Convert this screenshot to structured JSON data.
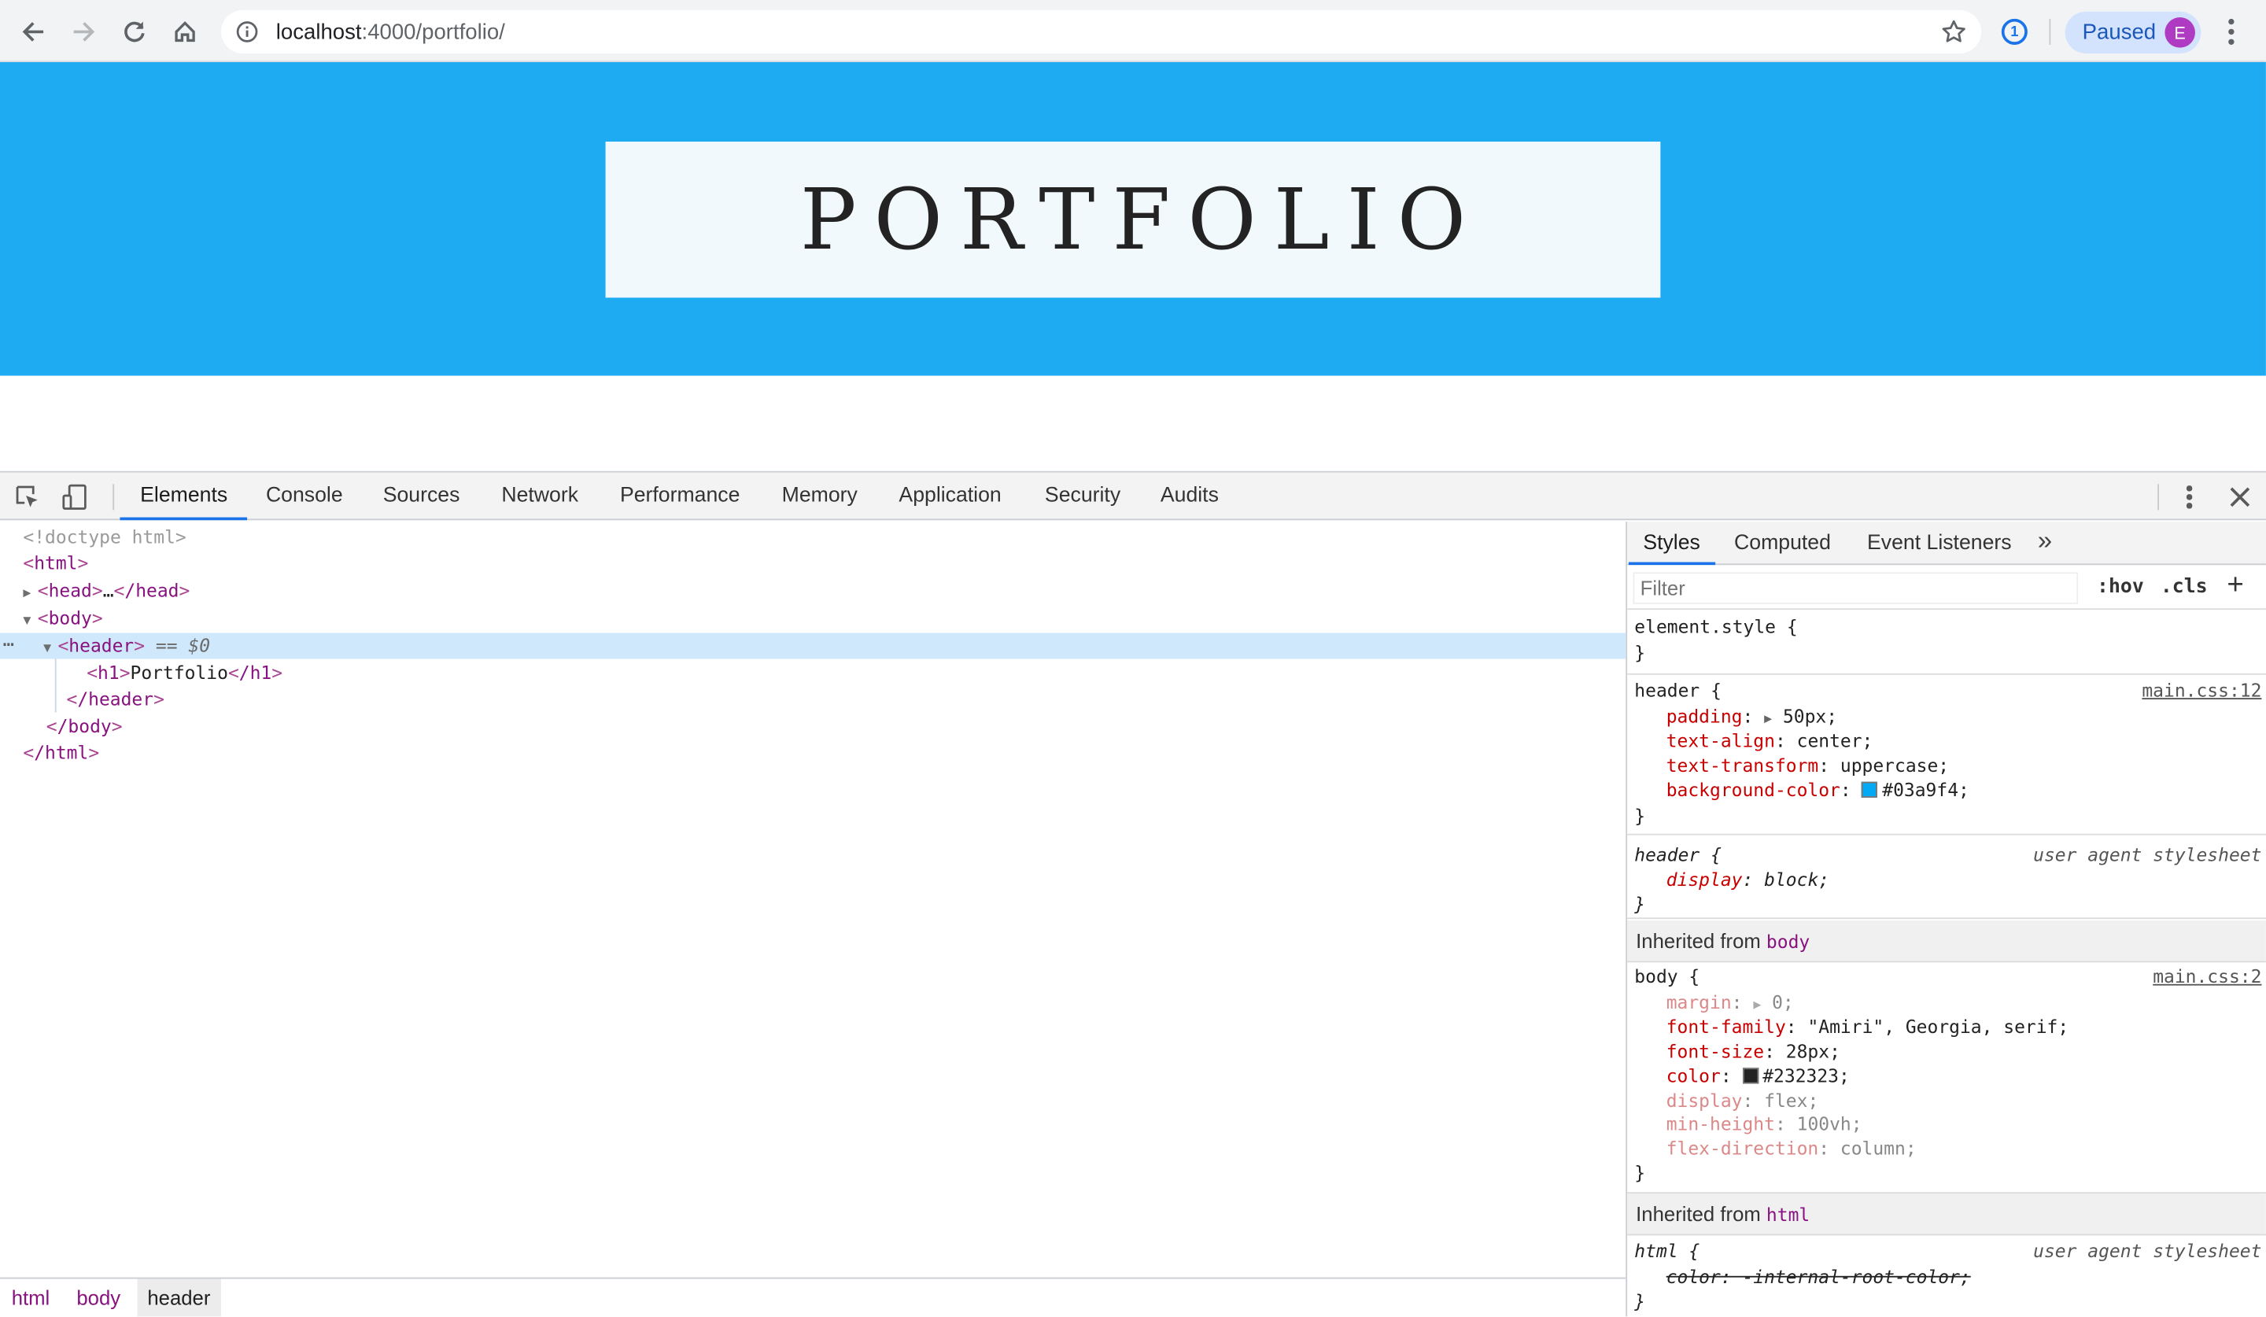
{
  "browser": {
    "url_host": "localhost",
    "url_path": ":4000/portfolio/",
    "paused_label": "Paused",
    "avatar_initial": "E",
    "extension_badge": "1"
  },
  "page": {
    "header_text": "PORTFOLIO",
    "header_bg": "#1fabf2"
  },
  "devtools": {
    "tabs": [
      "Elements",
      "Console",
      "Sources",
      "Network",
      "Performance",
      "Memory",
      "Application",
      "Security",
      "Audits"
    ],
    "dom": {
      "doctype": "<!doctype html>",
      "html_open": "html",
      "head_open": "head",
      "head_ellipsis": "…",
      "head_close": "/head",
      "body_open": "body",
      "header_open": "header",
      "selected_marker": "== $0",
      "h1_open": "h1",
      "h1_text": "Portfolio",
      "h1_close": "/h1",
      "header_close": "/header",
      "body_close": "/body",
      "html_close": "/html",
      "more": "…"
    },
    "breadcrumbs": [
      "html",
      "body",
      "header"
    ],
    "styles_pane": {
      "tabs": [
        "Styles",
        "Computed",
        "Event Listeners"
      ],
      "more": "»",
      "filter_placeholder": "Filter",
      "hov": ":hov",
      "cls": ".cls",
      "plus": "+",
      "element_style_selector": "element.style {",
      "close_brace": "}",
      "header_rule": {
        "selector": "header {",
        "source": "main.css:12",
        "padding_prop": "padding",
        "padding_val": "50px;",
        "text_align_prop": "text-align",
        "text_align_val": "center;",
        "text_transform_prop": "text-transform",
        "text_transform_val": "uppercase;",
        "bg_prop": "background-color",
        "bg_val": "#03a9f4;",
        "bg_swatch": "#03a9f4"
      },
      "ua_header_rule": {
        "selector": "header {",
        "source": "user agent stylesheet",
        "display_prop": "display",
        "display_val": "block;"
      },
      "inherited_body_label": "Inherited from",
      "inherited_body_tag": "body",
      "body_rule": {
        "selector": "body {",
        "source": "main.css:2",
        "margin_prop": "margin",
        "margin_val": "0;",
        "font_family_prop": "font-family",
        "font_family_val": "\"Amiri\", Georgia, serif;",
        "font_size_prop": "font-size",
        "font_size_val": "28px;",
        "color_prop": "color",
        "color_val": "#232323;",
        "color_swatch": "#232323",
        "display_prop": "display",
        "display_val": "flex;",
        "min_height_prop": "min-height",
        "min_height_val": "100vh;",
        "flex_direction_prop": "flex-direction",
        "flex_direction_val": "column;"
      },
      "inherited_html_label": "Inherited from",
      "inherited_html_tag": "html",
      "html_rule": {
        "selector": "html {",
        "source": "user agent stylesheet",
        "struck": "color: -internal-root-color;"
      }
    }
  }
}
